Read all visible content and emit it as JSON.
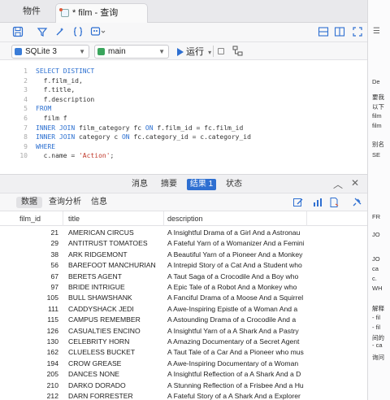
{
  "tabs": {
    "objects_label": "物件",
    "query_label": "* film - 查询"
  },
  "toolbar": {
    "connection": "SQLite 3",
    "database": "main",
    "run_label": "运行"
  },
  "editor": {
    "line_numbers": [
      "1",
      "2",
      "3",
      "4",
      "5",
      "6",
      "7",
      "8",
      "9"
    ],
    "lines": [
      {
        "kw": "SELECT DISTINCT",
        "rest": ""
      },
      {
        "kw": "",
        "rest": "  f.film_id,"
      },
      {
        "kw": "",
        "rest": "  f.title,"
      },
      {
        "kw": "",
        "rest": "  f.description"
      },
      {
        "kw": "FROM",
        "rest": ""
      },
      {
        "kw": "",
        "rest": "  film f"
      },
      {
        "kw": "INNER JOIN",
        "rest": " film_category fc ",
        "kw2": "ON",
        "rest2": " f.film_id = fc.film_id"
      },
      {
        "kw": "INNER JOIN",
        "rest": " category c ",
        "kw2": "ON",
        "rest2": " fc.category_id = c.category_id"
      },
      {
        "kw": "WHERE",
        "rest": ""
      }
    ],
    "last_line_prefix": "  c.name = ",
    "last_line_string": "'Action'",
    "last_line_suffix": ";"
  },
  "result_tabs": {
    "message": "消息",
    "summary": "摘要",
    "result1": "结果 1",
    "status": "状态"
  },
  "sub_tabs": {
    "data": "数据",
    "query_analysis": "查询分析",
    "info": "信息"
  },
  "grid": {
    "columns": [
      "film_id",
      "title",
      "description"
    ],
    "rows": [
      [
        "21",
        "AMERICAN CIRCUS",
        "A Insightful Drama of a Girl And a Astronau"
      ],
      [
        "29",
        "ANTITRUST TOMATOES",
        "A Fateful Yarn of a Womanizer And a Femini"
      ],
      [
        "38",
        "ARK RIDGEMONT",
        "A Beautiful Yarn of a Pioneer And a Monkey"
      ],
      [
        "56",
        "BAREFOOT MANCHURIAN",
        "A Intrepid Story of a Cat And a Student who"
      ],
      [
        "67",
        "BERETS AGENT",
        "A Taut Saga of a Crocodile And a Boy who"
      ],
      [
        "97",
        "BRIDE INTRIGUE",
        "A Epic Tale of a Robot And a Monkey who"
      ],
      [
        "105",
        "BULL SHAWSHANK",
        "A Fanciful Drama of a Moose And a Squirrel"
      ],
      [
        "111",
        "CADDYSHACK JEDI",
        "A Awe-Inspiring Epistle of a Woman And a"
      ],
      [
        "115",
        "CAMPUS REMEMBER",
        "A Astounding Drama of a Crocodile And a"
      ],
      [
        "126",
        "CASUALTIES ENCINO",
        "A Insightful Yarn of a A Shark And a Pastry"
      ],
      [
        "130",
        "CELEBRITY HORN",
        "A Amazing Documentary of a Secret Agent"
      ],
      [
        "162",
        "CLUELESS BUCKET",
        "A Taut Tale of a Car And a Pioneer who mus"
      ],
      [
        "194",
        "CROW GREASE",
        "A Awe-Inspiring Documentary of a Woman"
      ],
      [
        "205",
        "DANCES NONE",
        "A Insightful Reflection of a A Shark And a D"
      ],
      [
        "210",
        "DARKO DORADO",
        "A Stunning Reflection of a Frisbee And a Hu"
      ],
      [
        "212",
        "DARN FORRESTER",
        "A Fateful Story of a A Shark And a Explorer"
      ]
    ]
  },
  "right_panel": {
    "lines": [
      "De",
      "要我",
      "以下",
      "film",
      "film",
      "别名",
      "SE",
      "FR",
      "JO",
      "JO",
      "ca",
      "c.",
      "WH",
      "解释",
      "- fil",
      "- fil",
      "间的",
      "- ca",
      "询问"
    ]
  },
  "colors": {
    "accent": "#2e6fd1",
    "keyword": "#2b6fd0",
    "string": "#c0392b",
    "sqlite_icon": "#3b7dd8",
    "db_icon": "#3aa55d"
  }
}
